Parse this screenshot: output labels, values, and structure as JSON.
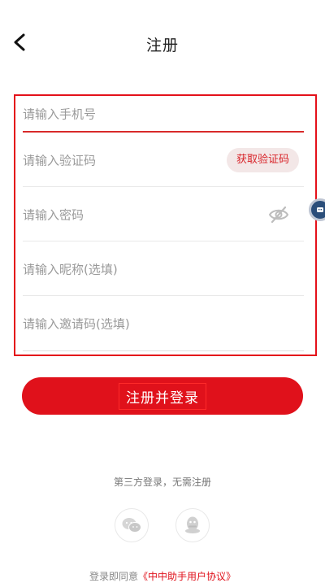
{
  "header": {
    "title": "注册",
    "back_icon": "chevron-left-icon"
  },
  "form": {
    "phone_placeholder": "请输入手机号",
    "code_placeholder": "请输入验证码",
    "get_code_label": "获取验证码",
    "password_placeholder": "请输入密码",
    "nickname_placeholder": "请输入昵称(选填)",
    "invite_placeholder": "请输入邀请码(选填)",
    "eye_icon": "eye-off-icon"
  },
  "submit": {
    "label": "注册并登录"
  },
  "third_party": {
    "title": "第三方登录，无需注册",
    "wechat_icon": "wechat-icon",
    "qq_icon": "qq-icon"
  },
  "agreement": {
    "prefix": "登录即同意",
    "link": "《中中助手用户协议》"
  },
  "colors": {
    "accent": "#e0111b",
    "placeholder": "#9a9a9a"
  }
}
